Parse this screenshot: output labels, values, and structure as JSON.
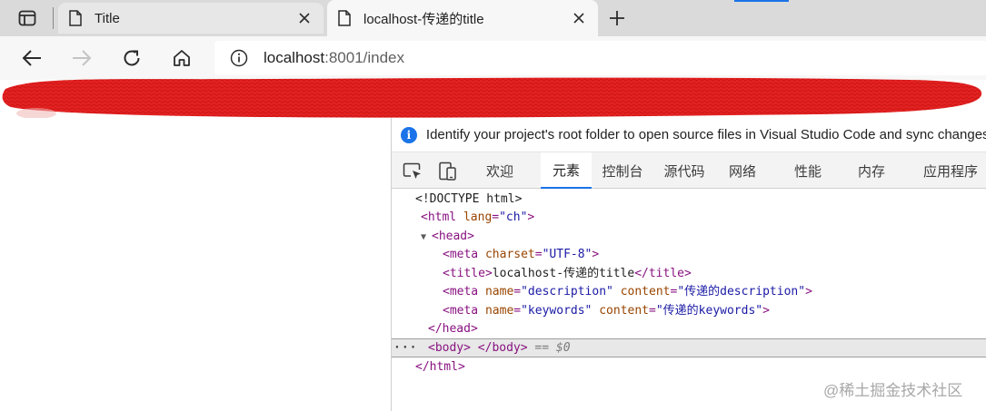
{
  "browser": {
    "tabs": [
      {
        "title": "Title",
        "active": false
      },
      {
        "title": "localhost-传递的title",
        "active": true
      }
    ],
    "url_host": "localhost",
    "url_rest": ":8001/index",
    "accent_color": "#1a73e8"
  },
  "devtools": {
    "infobar_message": "Identify your project's root folder to open source files in Visual Studio Code and sync changes",
    "tabs": [
      "欢迎",
      "元素",
      "控制台",
      "源代码",
      "网络",
      "性能",
      "内存",
      "应用程序"
    ],
    "selected_tab": "元素",
    "dom": {
      "doctype": "<!DOCTYPE html>",
      "html_open_tag": "html",
      "html_attr": "lang",
      "html_attr_val": "\"ch\"",
      "head_tag": "head",
      "meta_charset_attr": "charset",
      "meta_charset_val": "\"UTF-8\"",
      "title_text": "localhost-传递的title",
      "meta_desc_name_val": "\"description\"",
      "meta_desc_content_val": "\"传递的description\"",
      "meta_kw_name_val": "\"keywords\"",
      "meta_kw_content_val": "\"传递的keywords\"",
      "body_ref": "== $0",
      "dots": "···"
    }
  },
  "watermark": "@稀土掘金技术社区"
}
